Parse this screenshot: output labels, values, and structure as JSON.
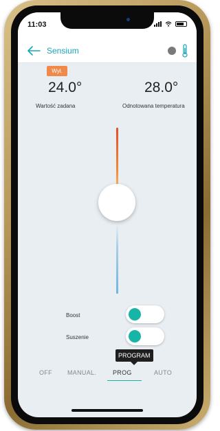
{
  "status_bar": {
    "time": "11:03"
  },
  "app_bar": {
    "title": "Sensium"
  },
  "status_badge": "Wył.",
  "set_temperature": {
    "value": "24.0°",
    "label": "Wartość zadana"
  },
  "measured_temperature": {
    "value": "28.0°",
    "label": "Odnotowana temperatura"
  },
  "toggles": [
    {
      "label": "Boost",
      "enabled": false
    },
    {
      "label": "Suszenie",
      "enabled": false
    }
  ],
  "tooltip": "PROGRAM",
  "modes": [
    "OFF",
    "MANUAL.",
    "PROG",
    "AUTO"
  ],
  "selected_mode": "PROG",
  "colors": {
    "accent": "#17b5a6",
    "title": "#15a6b8",
    "badge": "#f08a4b",
    "hot": "#e24e2b",
    "cold": "#6fb6e0",
    "background": "#e9eef2"
  }
}
